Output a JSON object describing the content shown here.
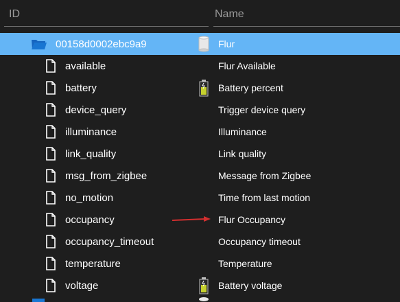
{
  "header": {
    "id_label": "ID",
    "name_label": "Name"
  },
  "root": {
    "id": "00158d0002ebc9a9",
    "name": "Flur",
    "icon": "device-cylinder-icon"
  },
  "states": [
    {
      "id": "available",
      "name": "Flur Available",
      "icon": ""
    },
    {
      "id": "battery",
      "name": "Battery percent",
      "icon": "battery-icon"
    },
    {
      "id": "device_query",
      "name": "Trigger device query",
      "icon": ""
    },
    {
      "id": "illuminance",
      "name": "Illuminance",
      "icon": ""
    },
    {
      "id": "link_quality",
      "name": "Link quality",
      "icon": ""
    },
    {
      "id": "msg_from_zigbee",
      "name": "Message from Zigbee",
      "icon": ""
    },
    {
      "id": "no_motion",
      "name": "Time from last motion",
      "icon": ""
    },
    {
      "id": "occupancy",
      "name": "Flur Occupancy",
      "icon": ""
    },
    {
      "id": "occupancy_timeout",
      "name": "Occupancy timeout",
      "icon": ""
    },
    {
      "id": "temperature",
      "name": "Temperature",
      "icon": ""
    },
    {
      "id": "voltage",
      "name": "Battery voltage",
      "icon": "battery-icon"
    }
  ],
  "colors": {
    "background": "#1e1e1e",
    "selected_row": "#64b5f6",
    "header_text": "#9a9a9a",
    "annotation_arrow": "#d32f2f"
  }
}
